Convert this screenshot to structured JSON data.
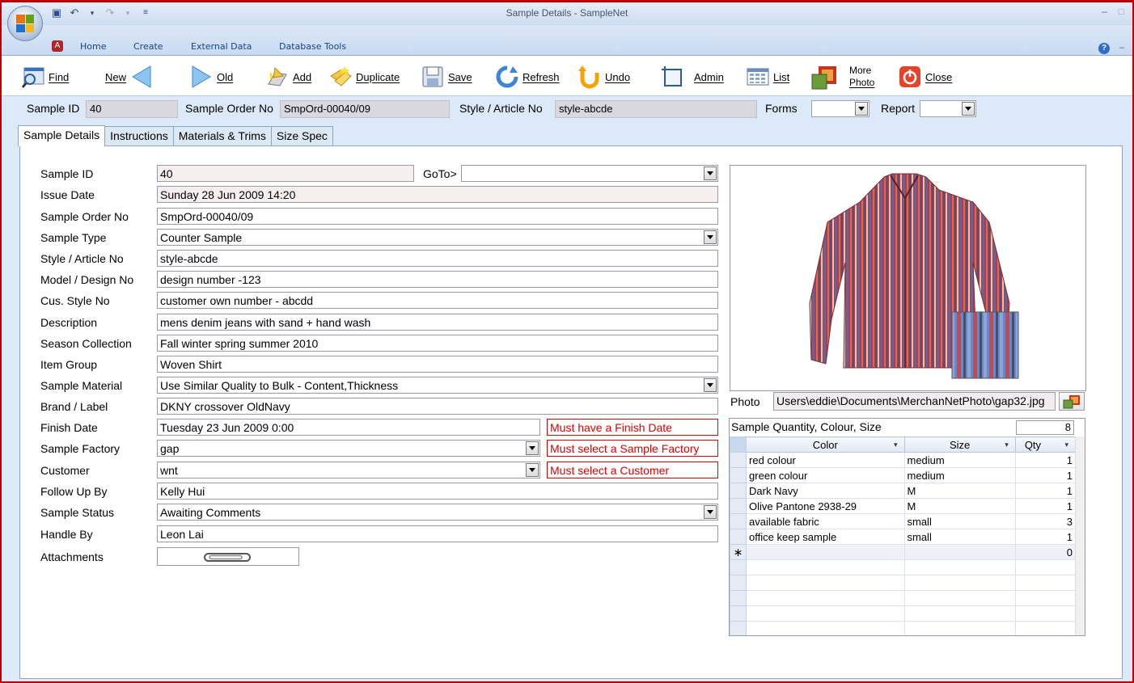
{
  "window": {
    "title": "Sample Details - SampleNet"
  },
  "ribbon_tabs": [
    "Home",
    "Create",
    "External Data",
    "Database Tools"
  ],
  "toolbar": {
    "find": "Find",
    "new": "New",
    "old": "Old",
    "add": "Add",
    "duplicate": "Duplicate",
    "save": "Save",
    "refresh": "Refresh",
    "undo": "Undo",
    "admin": "Admin",
    "list": "List",
    "more_photo_1": "More",
    "more_photo_2": "Photo",
    "close": "Close"
  },
  "header": {
    "sample_id_label": "Sample ID",
    "sample_id": "40",
    "order_label": "Sample Order No",
    "order": "SmpOrd-00040/09",
    "style_label": "Style / Article No",
    "style": "style-abcde",
    "forms_label": "Forms",
    "report_label": "Report"
  },
  "tabs": [
    "Sample Details",
    "Instructions",
    "Materials & Trims",
    "Size Spec"
  ],
  "form": {
    "goto_label": "GoTo>",
    "fields": [
      {
        "label": "Sample ID",
        "value": "40"
      },
      {
        "label": "Issue Date",
        "value": "Sunday 28 Jun 2009  14:20"
      },
      {
        "label": "Sample Order No",
        "value": "SmpOrd-00040/09"
      },
      {
        "label": "Sample Type",
        "value": "Counter Sample"
      },
      {
        "label": "Style / Article No",
        "value": "style-abcde"
      },
      {
        "label": "Model / Design No",
        "value": "design number -123"
      },
      {
        "label": "Cus. Style No",
        "value": "customer own number - abcdd"
      },
      {
        "label": "Description",
        "value": "mens denim jeans with sand + hand wash"
      },
      {
        "label": "Season Collection",
        "value": "Fall winter spring summer 2010"
      },
      {
        "label": "Item Group",
        "value": "Woven Shirt"
      },
      {
        "label": "Sample Material",
        "value": "Use Similar Quality to Bulk - Content,Thickness"
      },
      {
        "label": "Brand / Label",
        "value": "DKNY crossover OldNavy"
      },
      {
        "label": "Finish Date",
        "value": "Tuesday 23 Jun 2009  0:00"
      },
      {
        "label": "Sample Factory",
        "value": "gap"
      },
      {
        "label": "Customer",
        "value": "wnt"
      },
      {
        "label": "Follow Up By",
        "value": "Kelly Hui"
      },
      {
        "label": "Sample Status",
        "value": "Awaiting  Comments"
      },
      {
        "label": "Handle By",
        "value": "Leon Lai"
      },
      {
        "label": "Attachments",
        "value": ""
      }
    ],
    "errors": {
      "finish": "Must have a Finish Date",
      "factory": "Must select a Sample Factory",
      "customer": "Must select a Customer"
    }
  },
  "photo": {
    "label": "Photo",
    "path": "Users\\eddie\\Documents\\MerchanNetPhoto\\gap32.jpg"
  },
  "quantity": {
    "title": "Sample Quantity, Colour, Size",
    "total": "8",
    "columns": [
      "Color",
      "Size",
      "Qty"
    ],
    "rows": [
      {
        "color": "red colour",
        "size": "medium",
        "qty": "1"
      },
      {
        "color": "green colour",
        "size": "medium",
        "qty": "1"
      },
      {
        "color": "Dark Navy",
        "size": "M",
        "qty": "1"
      },
      {
        "color": "Olive Pantone 2938-29",
        "size": "M",
        "qty": "1"
      },
      {
        "color": "available fabric",
        "size": "small",
        "qty": "3"
      },
      {
        "color": "office keep sample",
        "size": "small",
        "qty": "1"
      }
    ],
    "new_row_qty": "0"
  }
}
